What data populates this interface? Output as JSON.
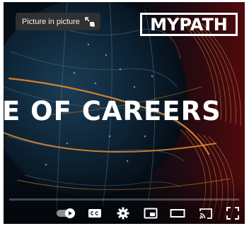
{
  "player": {
    "tooltip_text": "Picture in picture",
    "logo_text": "MYPATH",
    "headline_text": "E OF CAREERS",
    "progress_fraction": 0,
    "autoplay_on": true,
    "colors": {
      "accent": "#e98a2c",
      "player_bg": "#050d16",
      "text": "#ffffff"
    }
  },
  "controls": [
    {
      "name": "autoplay-toggle",
      "icon": "autoplay-toggle-icon"
    },
    {
      "name": "captions-button",
      "icon": "cc-icon"
    },
    {
      "name": "settings-button",
      "icon": "gear-icon"
    },
    {
      "name": "miniplayer-button",
      "icon": "miniplayer-icon"
    },
    {
      "name": "theater-mode-button",
      "icon": "theater-icon"
    },
    {
      "name": "cast-button",
      "icon": "cast-icon"
    },
    {
      "name": "fullscreen-button",
      "icon": "fullscreen-icon"
    }
  ]
}
